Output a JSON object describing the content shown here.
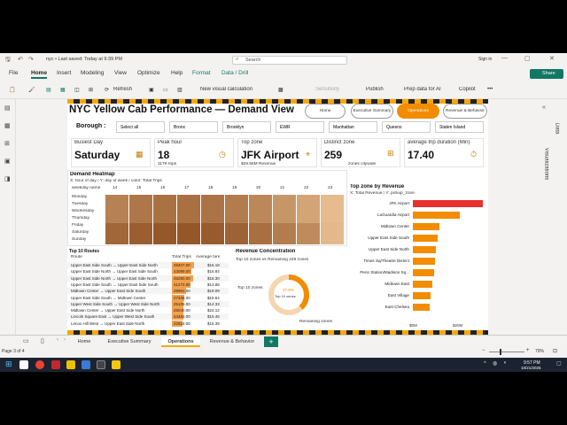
{
  "titlebar": {
    "filename": "nyc • Last saved: Today at 9:39 PM",
    "search_placeholder": "Search",
    "signin": "Sign in"
  },
  "ribbon_tabs": [
    "File",
    "Home",
    "Insert",
    "Modeling",
    "View",
    "Optimize",
    "Help",
    "Format",
    "Data / Drill"
  ],
  "share_label": "Share",
  "toolbar": {
    "refresh": "Refresh",
    "new_visual_calc": "New visual calculation",
    "sensitivity": "Sensitivity",
    "publish": "Publish",
    "prep_data": "Prep data for AI",
    "copilot": "Copilot"
  },
  "report": {
    "title": "NYC Yellow Cab Performance — Demand View",
    "nav": [
      "Home",
      "Executive Summary",
      "Operations",
      "Revenue & Behavior"
    ],
    "borough_label": "Borough :",
    "boroughs": [
      "Select all",
      "Bronx",
      "Brooklyn",
      "EWR",
      "Manhattan",
      "Queens",
      "Staten Island"
    ],
    "kpis": [
      {
        "label": "Busiest Day",
        "value": "Saturday",
        "sub": ""
      },
      {
        "label": "Peak hour",
        "value": "18",
        "sub": "117K trips"
      },
      {
        "label": "Top zone",
        "value": "JFK Airport",
        "sub": "$29.66M Revenue"
      },
      {
        "label": "Distinct zone",
        "value": "259",
        "sub": "zones citywide"
      },
      {
        "label": "average trip duration (Min)",
        "value": "17.40",
        "sub": ""
      }
    ],
    "heatmap": {
      "title": "Demand Heatmap",
      "subtitle": "X: hour of day / Y: day of week / color: Total Trips",
      "corner": "weekday name",
      "hours": [
        "14",
        "15",
        "16",
        "17",
        "18",
        "19",
        "20",
        "21",
        "22",
        "23"
      ],
      "days": [
        "Monday",
        "Tuesday",
        "Wednesday",
        "Thursday",
        "Friday",
        "Saturday",
        "Sunday"
      ],
      "colors": {
        "low": "#f0c89a",
        "high": "#8a4a1c"
      }
    },
    "top_zone": {
      "title": "Top zone by Revenue",
      "subtitle": "X: Total Revenue / Y: pickup_zone",
      "zones": [
        "JFK Airport",
        "LaGuardia Airport",
        "Midtown Center",
        "Upper East Side South",
        "Upper East Side North",
        "Times Sq/Theatre District",
        "Penn Station/Madison Sq...",
        "Midtown East",
        "East Village",
        "East Chelsea"
      ],
      "values": [
        29.66,
        19.8,
        11.2,
        10.6,
        9.9,
        9.4,
        8.9,
        8.2,
        7.6,
        7.2
      ],
      "axis": [
        "$0M",
        "$20M"
      ],
      "colors": {
        "top": "#e8312f",
        "rest": "#f28c00"
      }
    },
    "routes": {
      "title": "Top 10 Routes",
      "headers": [
        "Route",
        "Total Trips",
        "Average fare"
      ],
      "rows": [
        [
          "Upper East Side South → Upper East Side North",
          "48407.00",
          "$16.18"
        ],
        [
          "Upper East Side North → Upper East Side South",
          "43089.00",
          "$16.84"
        ],
        [
          "Upper East Side North → Upper East Side North",
          "45280.00",
          "$16.30"
        ],
        [
          "Upper East Side South → Upper East Side South",
          "41273.00",
          "$14.88"
        ],
        [
          "Midtown Center → Upper East Side South",
          "29961.00",
          "$19.09"
        ],
        [
          "Upper East Side South → Midtown Center",
          "27336.00",
          "$19.54"
        ],
        [
          "Upper West Side South → Upper West Side North",
          "25105.00",
          "$14.33"
        ],
        [
          "Midtown Center → Upper East Side North",
          "25040.00",
          "$24.12"
        ],
        [
          "Lincoln Square East → Upper West Side South",
          "24462.00",
          "$15.45"
        ],
        [
          "Lenox Hill West → Upper East Side North",
          "22618.00",
          "$16.39"
        ]
      ],
      "trip_fill": [
        1.0,
        0.89,
        0.94,
        0.85,
        0.62,
        0.56,
        0.52,
        0.52,
        0.51,
        0.47
      ]
    },
    "concentration": {
      "title": "Revenue Concentration",
      "subtitle": "Top 10 zones vs Remaining 249 zones",
      "legend_top": "Top 10 zones",
      "legend_rest": "Remaining zones",
      "center_pct": "37.9%",
      "center_lab": "Top 10 zones",
      "share": 0.379
    }
  },
  "page_tabs": [
    "Home",
    "Executive Summary",
    "Operations",
    "Revenue & Behavior"
  ],
  "status": {
    "page": "Page 3 of 4",
    "zoom": "79%"
  },
  "clock": {
    "time": "9:57 PM",
    "date": "10/21/2025"
  }
}
